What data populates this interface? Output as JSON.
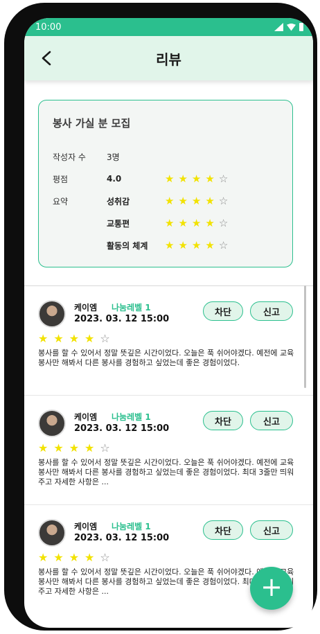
{
  "status_bar": {
    "time": "10:00"
  },
  "header": {
    "title": "리뷰"
  },
  "summary": {
    "title": "봉사 가실 분 모집",
    "writers_label": "작성자 수",
    "writers_value": "3명",
    "rating_label": "평점",
    "rating_value": "4.0",
    "rating_stars": 4,
    "summary_label": "요약",
    "items": [
      {
        "label": "성취감",
        "stars": 4
      },
      {
        "label": "교통편",
        "stars": 4
      },
      {
        "label": "활동의 체계",
        "stars": 4
      }
    ]
  },
  "actions": {
    "block": "차단",
    "report": "신고",
    "fab": "+"
  },
  "reviews": [
    {
      "author": "케이엠",
      "level": "나눔레벨 1",
      "date": "2023. 03. 12 15:00",
      "stars": 4,
      "text": "봉사를 할 수 있어서 정말 뜻깊은 시간이었다. 오늘은 푹 쉬어야겠다. 예전에 교육봉사만 해봐서 다른 봉사를 경험하고 싶었는데 좋은 경험이었다."
    },
    {
      "author": "케이엠",
      "level": "나눔레벨 1",
      "date": "2023. 03. 12 15:00",
      "stars": 4,
      "text": "봉사를 할 수 있어서 정말 뜻깊은 시간이었다. 오늘은 푹 쉬어야겠다. 예전에 교육봉사만 해봐서 다른 봉사를 경험하고 싶었는데 좋은 경험이었다. 최대 3줄만 띄워주고 자세한 사항은 ..."
    },
    {
      "author": "케이엠",
      "level": "나눔레벨 1",
      "date": "2023. 03. 12 15:00",
      "stars": 4,
      "text": "봉사를 할 수 있어서 정말 뜻깊은 시간이었다. 오늘은 푹 쉬어야겠다. 예전에 교육봉사만 해봐서 다른 봉사를 경험하고 싶었는데 좋은 경험이었다. 최대 3줄만 띄워주고 자세한 사항은 ..."
    }
  ],
  "colors": {
    "accent": "#2bbf8e",
    "header_bg": "#e1f5ea",
    "star": "#f2e200"
  },
  "icons": {
    "back": "arrow-left-icon",
    "add": "plus-icon",
    "star": "star-icon"
  }
}
